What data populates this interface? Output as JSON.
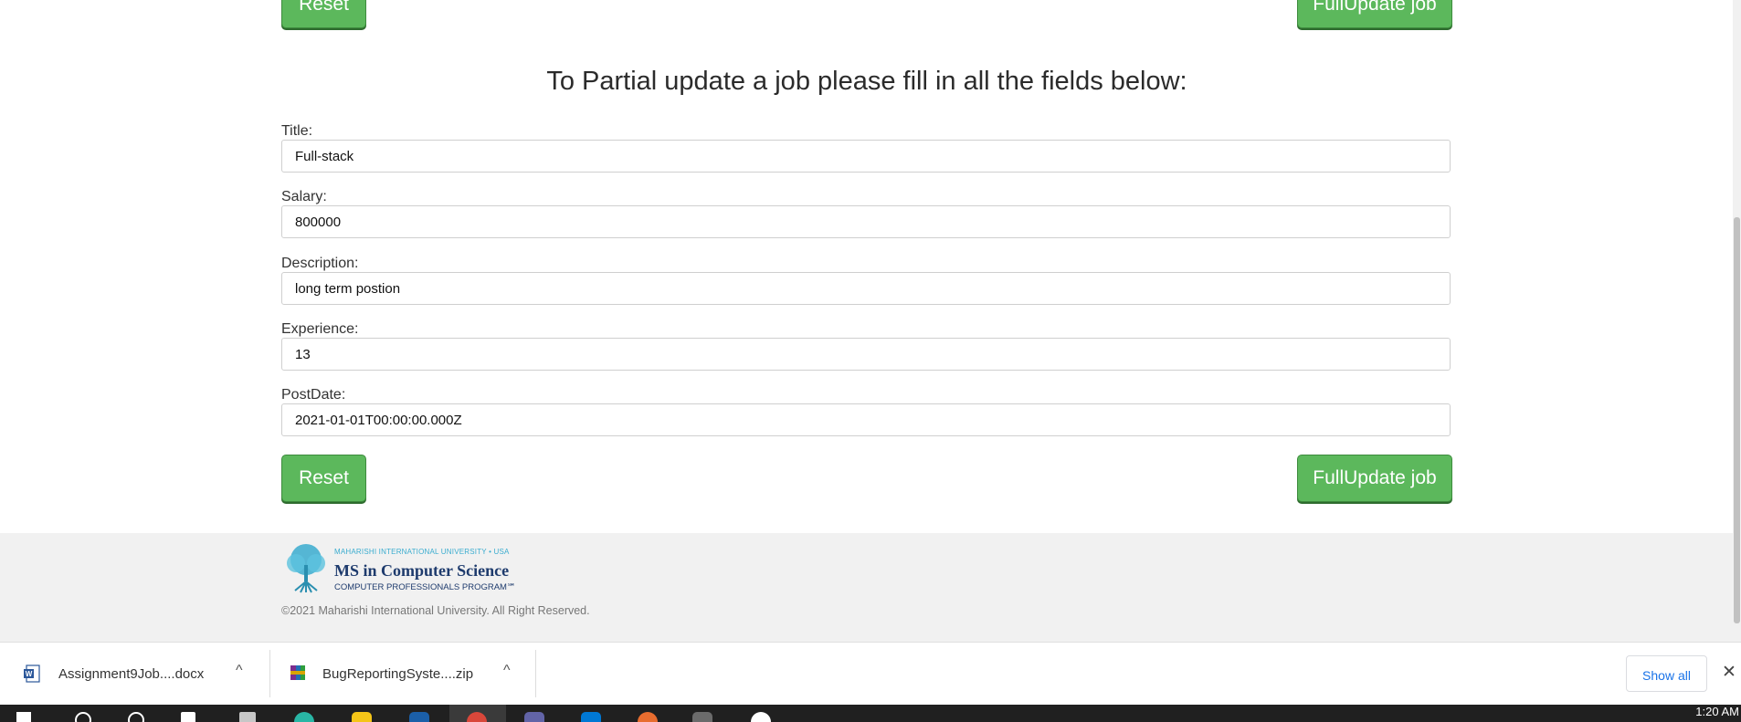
{
  "form": {
    "reset_label": "Reset",
    "full_update_label": "FullUpdate job",
    "heading": "To Partial update a job please fill in all the fields below:",
    "fields": [
      {
        "label": "Title:",
        "value": "Full-stack"
      },
      {
        "label": "Salary:",
        "value": "800000"
      },
      {
        "label": "Description:",
        "value": "long term postion"
      },
      {
        "label": "Experience:",
        "value": "13"
      },
      {
        "label": "PostDate:",
        "value": "2021-01-01T00:00:00.000Z"
      }
    ]
  },
  "footer": {
    "logo_tiny": "MAHARISHI INTERNATIONAL UNIVERSITY • USA",
    "logo_main": "MS in Computer Science",
    "logo_sub": "COMPUTER PROFESSIONALS PROGRAM℠",
    "copyright": "©2021 Maharishi International University. All Right Reserved."
  },
  "downloads": {
    "items": [
      {
        "name": "Assignment9Job....docx",
        "icon": "word-doc-icon"
      },
      {
        "name": "BugReportingSyste....zip",
        "icon": "winrar-zip-icon"
      }
    ],
    "show_all_label": "Show all"
  },
  "taskbar": {
    "time": "1:20 AM"
  },
  "colors": {
    "button_green": "#5cb85c",
    "footer_bg": "#f1f1f1",
    "logo_blue": "#1e3b6d",
    "logo_teal": "#3aaccf",
    "link_blue": "#1a73e8"
  }
}
